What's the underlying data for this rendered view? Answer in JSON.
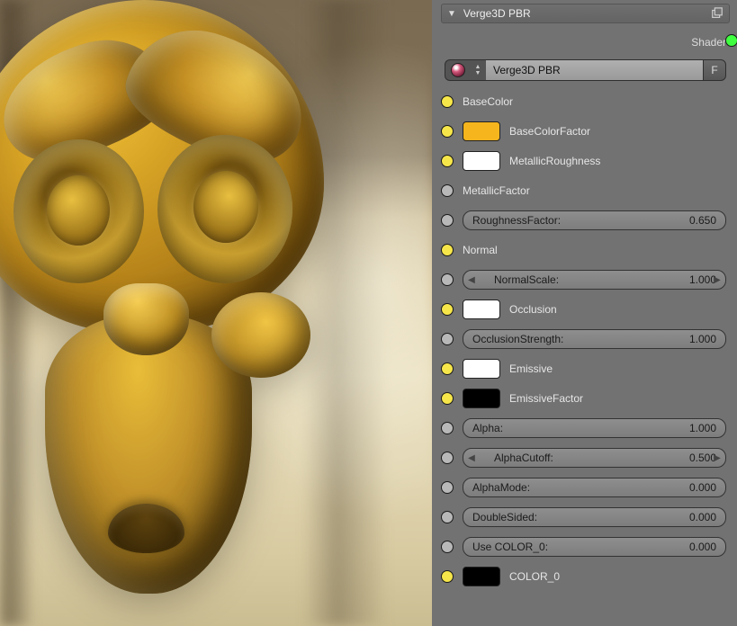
{
  "panel": {
    "title": "Verge3D PBR",
    "output_label": "Shader",
    "node_group_name": "Verge3D PBR",
    "fake_user_label": "F"
  },
  "sockets": {
    "baseColor_label": "BaseColor",
    "baseColorFactor_label": "BaseColorFactor",
    "baseColorFactor_swatch": "#f6b51d",
    "metallicRoughness_label": "MetallicRoughness",
    "metallicRoughness_swatch": "#ffffff",
    "metallicFactor_label": "MetallicFactor",
    "roughnessFactor_label": "RoughnessFactor:",
    "roughnessFactor_value": "0.650",
    "normal_label": "Normal",
    "normalScale_label": "NormalScale:",
    "normalScale_value": "1.000",
    "occlusion_label": "Occlusion",
    "occlusion_swatch": "#ffffff",
    "occlusionStrength_label": "OcclusionStrength:",
    "occlusionStrength_value": "1.000",
    "emissive_label": "Emissive",
    "emissive_swatch": "#ffffff",
    "emissiveFactor_label": "EmissiveFactor",
    "emissiveFactor_swatch": "#000000",
    "alpha_label": "Alpha:",
    "alpha_value": "1.000",
    "alphaCutoff_label": "AlphaCutoff:",
    "alphaCutoff_value": "0.500",
    "alphaMode_label": "AlphaMode:",
    "alphaMode_value": "0.000",
    "doubleSided_label": "DoubleSided:",
    "doubleSided_value": "0.000",
    "useColor0_label": "Use COLOR_0:",
    "useColor0_value": "0.000",
    "color0_label": "COLOR_0",
    "color0_swatch": "#000000"
  }
}
